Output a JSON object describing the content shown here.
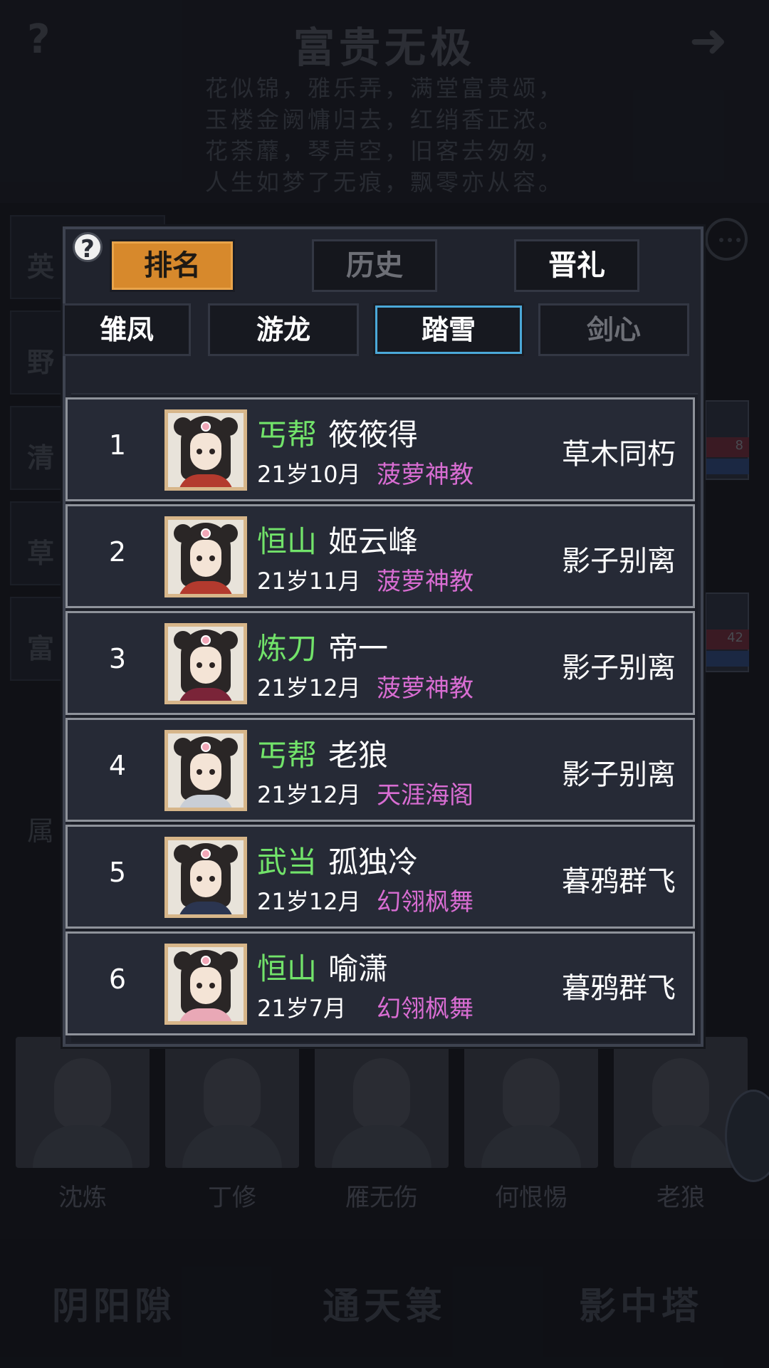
{
  "background": {
    "title": "富贵无极",
    "poem": [
      "花似锦，雅乐弄，满堂富贵颂，",
      "玉楼金阙慵归去，红绡香正浓。",
      "花荼蘼，琴声空，旧客去匆匆，",
      "人生如梦了无痕，飘零亦从容。"
    ],
    "side_items": [
      "英",
      "野",
      "清",
      "草",
      "富"
    ],
    "right_card_values": [
      "8",
      "42"
    ],
    "attr_label": "属",
    "portrait_names": [
      "沈炼",
      "丁修",
      "雁无伤",
      "何恨惕",
      "老狼"
    ],
    "bottom_buttons": [
      "阴阳隙",
      "通天箓",
      "影中塔"
    ]
  },
  "modal": {
    "help": "?",
    "tabs": [
      "排名",
      "历史",
      "晋礼"
    ],
    "subtabs": [
      "雏凤",
      "游龙",
      "踏雪",
      "剑心"
    ],
    "rows": [
      {
        "rank": "1",
        "sect": "丐帮",
        "name": "筱筱得",
        "age": "21岁10月",
        "guild": "菠萝神教",
        "title": "草木同朽",
        "robe": "#b33a2e"
      },
      {
        "rank": "2",
        "sect": "恒山",
        "name": "姬云峰",
        "age": "21岁11月",
        "guild": "菠萝神教",
        "title": "影子别离",
        "robe": "#b33a2e"
      },
      {
        "rank": "3",
        "sect": "炼刀",
        "name": "帝一",
        "age": "21岁12月",
        "guild": "菠萝神教",
        "title": "影子别离",
        "robe": "#7a2438"
      },
      {
        "rank": "4",
        "sect": "丐帮",
        "name": "老狼",
        "age": "21岁12月",
        "guild": "天涯海阁",
        "title": "影子别离",
        "robe": "#c9ced6"
      },
      {
        "rank": "5",
        "sect": "武当",
        "name": "孤独冷",
        "age": "21岁12月",
        "guild": "幻翎枫舞",
        "title": "暮鸦群飞",
        "robe": "#2b3550"
      },
      {
        "rank": "6",
        "sect": "恒山",
        "name": "喻潇",
        "age": "21岁7月",
        "guild": "幻翎枫舞",
        "title": "暮鸦群飞",
        "robe": "#e9a8b6"
      }
    ]
  },
  "colors": {
    "sect": "#72e36a",
    "guild": "#d86dd2",
    "tab_active": "#d7892c",
    "subtab_active": "#2e8fc6"
  }
}
